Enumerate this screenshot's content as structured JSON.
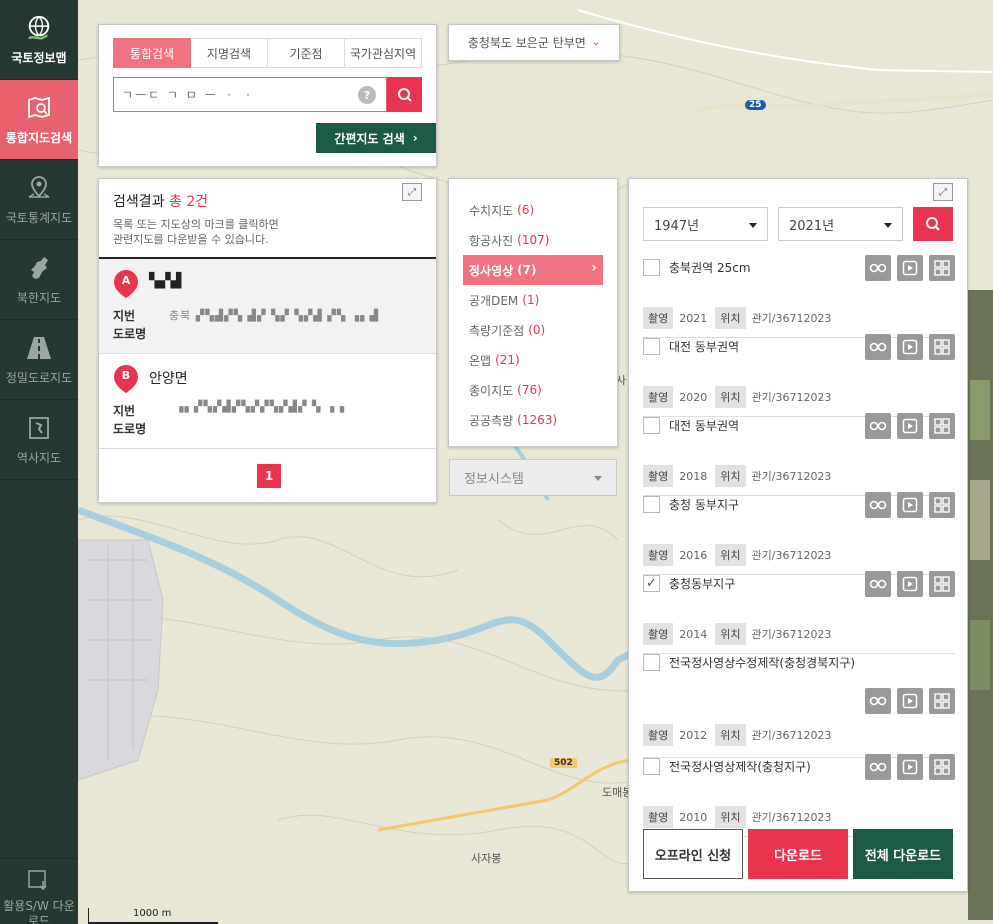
{
  "sidebar": {
    "brand_label": "국토정보맵",
    "items": [
      {
        "label": "통합지도검색"
      },
      {
        "label": "국토통계지도"
      },
      {
        "label": "북한지도"
      },
      {
        "label": "정밀도로지도"
      },
      {
        "label": "역사지도"
      }
    ],
    "bottom_label": "활용S/W 다운로드"
  },
  "search": {
    "tabs": [
      "통합검색",
      "지명검색",
      "기준점",
      "국가관심지역"
    ],
    "active_tab": "통합검색",
    "query": "ㄱㅡㄷ ㄱ ㅁ ㅡ ㆍ ㆍ",
    "help": "?",
    "easy_map_button": "간편지도 검색"
  },
  "region": {
    "label": "충청북도 보은군 탄부면"
  },
  "results": {
    "title_prefix": "검색결과",
    "title_count": "총 2건",
    "desc_line1": "목록 또는 지도상의 마크를 클릭하면",
    "desc_line2": "관련지도를 다운받을 수 있습니다.",
    "items": [
      {
        "marker": "A",
        "name": "▚▞▟",
        "jibun_label": "지번",
        "road_label": "도로명",
        "jibun_value": "충북 ▞▚▟▞▚ ▟▞ ▚▞ ▚▞▟ ▞▚ ▗▖▟",
        "road_value": ""
      },
      {
        "marker": "B",
        "name": "안양면",
        "jibun_label": "지번",
        "road_label": "도로명",
        "jibun_value": "▗▖▞▚▞▟▞▚▞▞▚▞▟▞ ▚ ▗ ▖",
        "road_value": ""
      }
    ],
    "page": "1"
  },
  "categories": [
    {
      "label": "수치지도",
      "count": "(6)"
    },
    {
      "label": "항공사진",
      "count": "(107)"
    },
    {
      "label": "정사영상",
      "count": "(7)"
    },
    {
      "label": "공개DEM",
      "count": "(1)"
    },
    {
      "label": "측량기준점",
      "count": "(0)"
    },
    {
      "label": "온맵",
      "count": "(21)"
    },
    {
      "label": "종이지도",
      "count": "(76)"
    },
    {
      "label": "공공측량",
      "count": "(1263)"
    }
  ],
  "info_system": {
    "label": "정보시스템"
  },
  "imagery": {
    "year_from": "1947년",
    "year_to": "2021년",
    "tag_shoot": "촬영",
    "tag_location": "위치",
    "items": [
      {
        "name": "충북권역 25cm",
        "year": "2021",
        "location": "관기/36712023",
        "checked": false
      },
      {
        "name": "대전 동부권역",
        "year": "2020",
        "location": "관기/36712023",
        "checked": false
      },
      {
        "name": "대전 동부권역",
        "year": "2018",
        "location": "관기/36712023",
        "checked": false
      },
      {
        "name": "충청 동부지구",
        "year": "2016",
        "location": "관기/36712023",
        "checked": false
      },
      {
        "name": "충청동부지구",
        "year": "2014",
        "location": "관기/36712023",
        "checked": true
      },
      {
        "name": "전국정사영상수정제작(충청경북지구)",
        "year": "2012",
        "location": "관기/36712023",
        "checked": false
      },
      {
        "name": "전국정사영상제작(충청지구)",
        "year": "2010",
        "location": "관기/36712023",
        "checked": false
      }
    ],
    "offline_button": "오프라인 신청",
    "download_button": "다운로드",
    "download_all_button": "전체 다운로드"
  },
  "map": {
    "labels": [
      "사자봉",
      "도매봉",
      "사"
    ],
    "road_25": "25",
    "road_502": "502",
    "scale": "1000 m"
  },
  "colors": {
    "accent": "#e8344e",
    "accent_soft": "#f07280",
    "dark_green": "#1c5a48",
    "sidebar": "#253832"
  }
}
